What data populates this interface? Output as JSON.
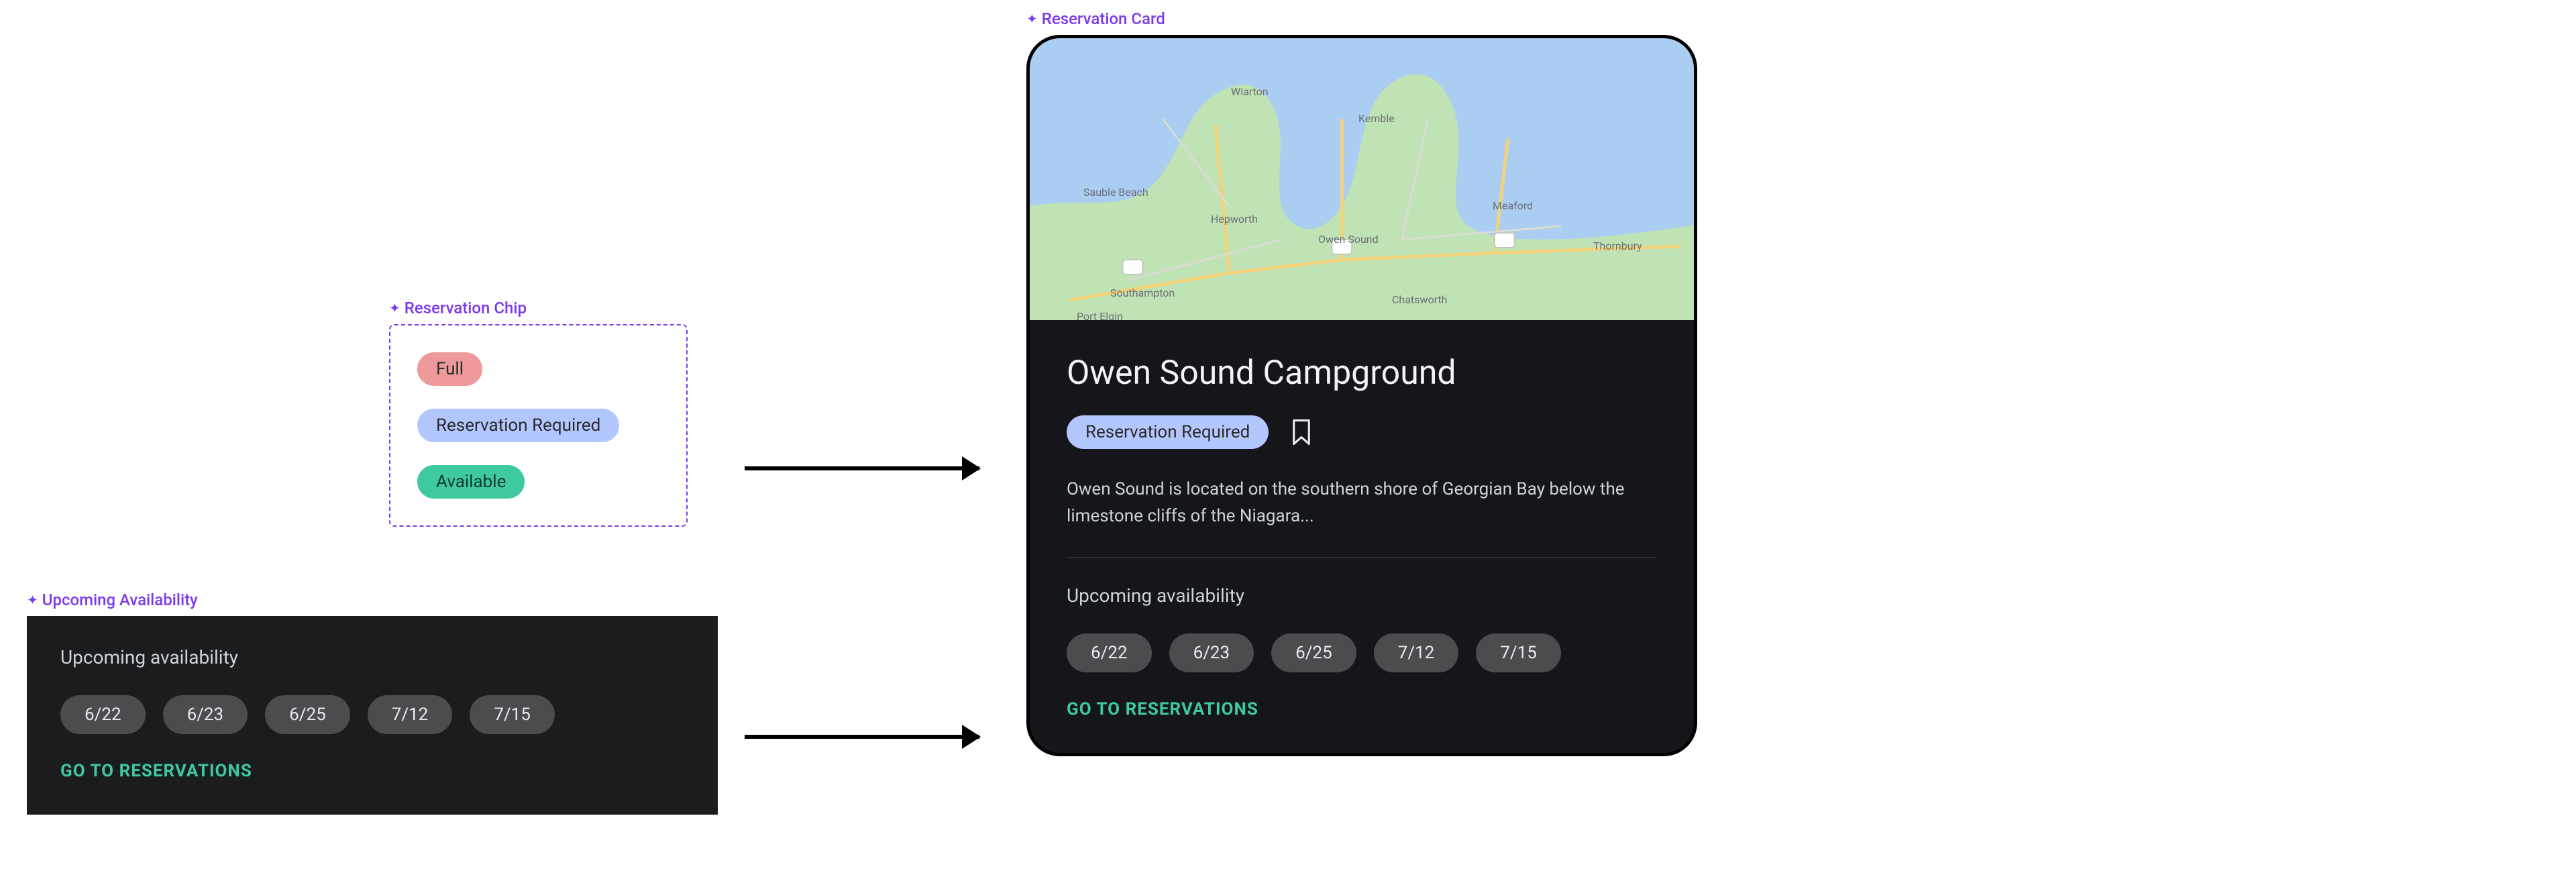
{
  "sections": {
    "chip_label": "Reservation Chip",
    "avail_label": "Upcoming Availability",
    "card_label": "Reservation Card"
  },
  "chips": {
    "full": "Full",
    "reservation_required": "Reservation Required",
    "available": "Available"
  },
  "availability": {
    "heading": "Upcoming availability",
    "dates": [
      "6/22",
      "6/23",
      "6/25",
      "7/12",
      "7/15"
    ],
    "cta": "GO TO RESERVATIONS"
  },
  "card": {
    "title": "Owen Sound Campground",
    "status_chip": "Reservation Required",
    "description": "Owen Sound is located on the southern shore of Georgian Bay below the limestone cliffs of the Niagara...",
    "availability_heading": "Upcoming availability",
    "dates": [
      "6/22",
      "6/23",
      "6/25",
      "7/12",
      "7/15"
    ],
    "cta": "GO TO RESERVATIONS",
    "map_places": [
      "Wiarton",
      "Kemble",
      "Sauble Beach",
      "Hepworth",
      "Owen Sound",
      "Meaford",
      "Thornbury",
      "Southampton",
      "Chatsworth",
      "Port Elgin"
    ]
  },
  "colors": {
    "accent_purple": "#7c3aed",
    "chip_full_bg": "#ef9a9a",
    "chip_res_bg": "#b3c7ff",
    "chip_avail_bg": "#3ec9a0",
    "card_bg": "#14161a",
    "cta_green": "#3ec9a0"
  }
}
